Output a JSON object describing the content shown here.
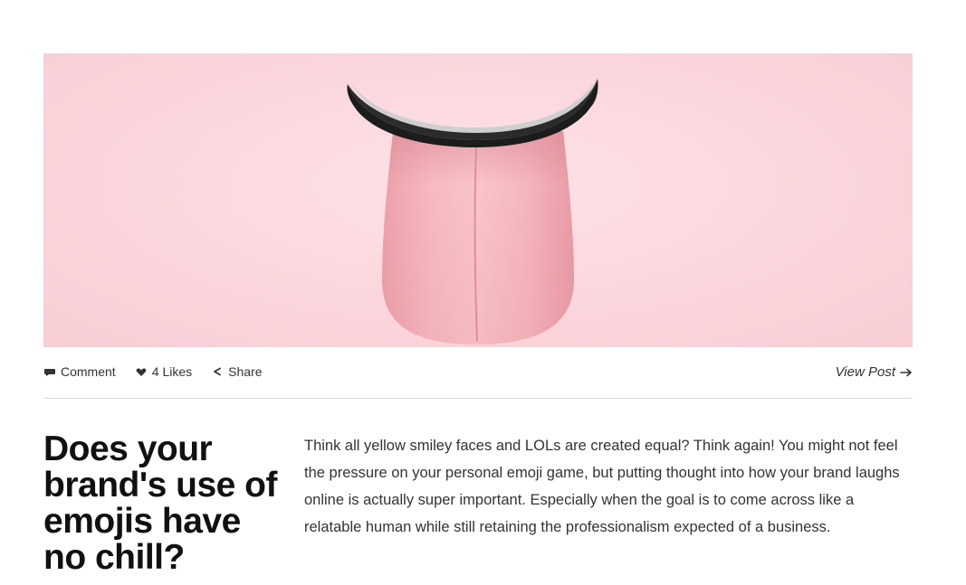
{
  "hero_image": {
    "subject": "tongue-sticking-out-emoji",
    "colors": {
      "background": "#fbd6dc",
      "tongue": "#f2a9b1",
      "lip": "#1c1c1c"
    }
  },
  "post_meta": {
    "comment_label": "Comment",
    "likes_count": "4",
    "likes_label": "Likes",
    "share_label": "Share",
    "view_post_label": "View Post"
  },
  "post": {
    "title": "Does your brand's use of emojis have no chill?",
    "excerpt": "Think all yellow smiley faces and LOLs are created equal? Think again! You might not feel the pressure on your personal emoji game, but putting thought into how your brand laughs online is actually super important. Especially when the goal is to come across like a relatable human while still retaining the professionalism expected of a business."
  },
  "icons": {
    "comment": "speech-bubble",
    "likes": "heart",
    "share": "share-arrow",
    "view_post": "right-arrow"
  }
}
